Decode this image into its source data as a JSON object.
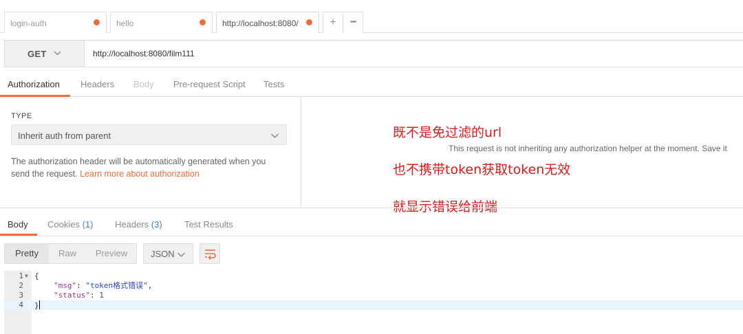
{
  "tabs": [
    {
      "label": "login-auth"
    },
    {
      "label": "hello"
    },
    {
      "label": "http://localhost:8080/"
    }
  ],
  "tab_controls": {
    "new_tab": "+",
    "more": "•••"
  },
  "request": {
    "method": "GET",
    "url": "http://localhost:8080/film111"
  },
  "request_tabs": [
    "Authorization",
    "Headers",
    "Body",
    "Pre-request Script",
    "Tests"
  ],
  "auth": {
    "type_label": "TYPE",
    "type_value": "Inherit auth from parent",
    "description": "The authorization header will be automatically generated when you send the request.",
    "link": "Learn more about authorization",
    "info": "This request is not inheriting any authorization helper at the moment. Save it"
  },
  "annotations": [
    "既不是免过滤的url",
    "也不携带token获取token无效",
    "就显示错误给前端"
  ],
  "response_tabs": [
    {
      "label": "Body",
      "count": ""
    },
    {
      "label": "Cookies",
      "count": "(1)"
    },
    {
      "label": "Headers",
      "count": "(3)"
    },
    {
      "label": "Test Results",
      "count": ""
    }
  ],
  "view_modes": [
    "Pretty",
    "Raw",
    "Preview"
  ],
  "format": "JSON",
  "code": {
    "line_numbers": [
      "1",
      "2",
      "3",
      "4"
    ],
    "open_brace": "{",
    "msg_key": "\"msg\"",
    "msg_value": "\"token格式错误\"",
    "status_key": "\"status\"",
    "status_value": "1",
    "close_brace": "}"
  },
  "colors": {
    "accent": "#f26b3a",
    "annotation": "#e01818",
    "count": "#4a7fcb"
  }
}
